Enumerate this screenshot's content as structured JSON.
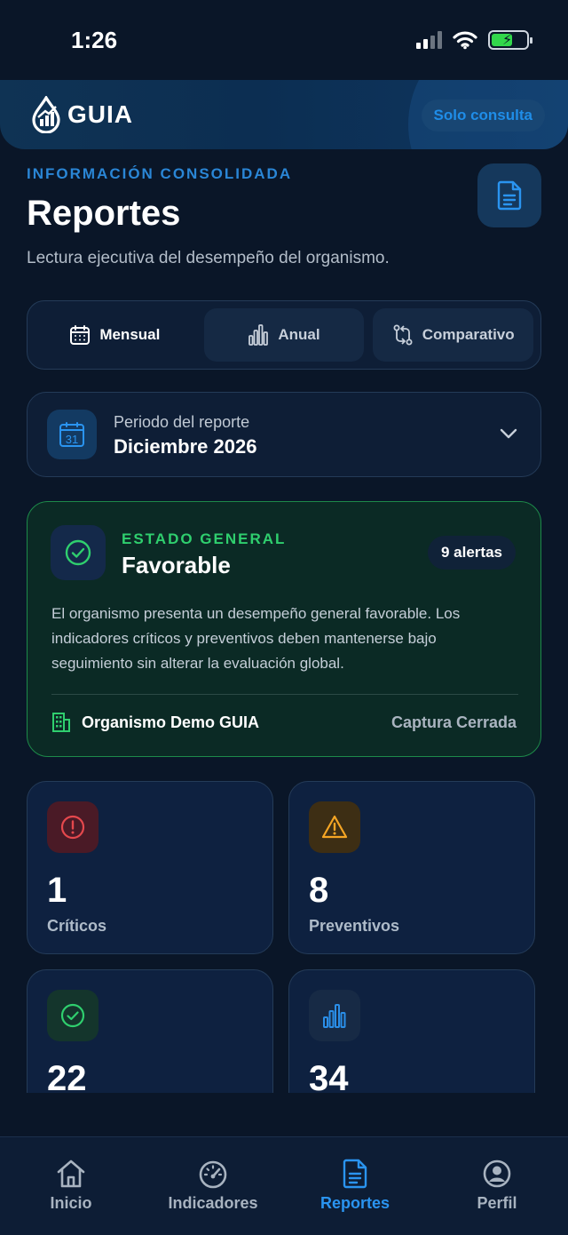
{
  "status_bar": {
    "time": "1:26"
  },
  "header": {
    "logo_text": "GUIA",
    "badge": "Solo consulta"
  },
  "page": {
    "eyebrow": "INFORMACIÓN CONSOLIDADA",
    "title": "Reportes",
    "subtitle": "Lectura ejecutiva del desempeño del organismo."
  },
  "segment": {
    "items": [
      {
        "label": "Mensual",
        "icon": "calendar-icon"
      },
      {
        "label": "Anual",
        "icon": "bar-chart-icon"
      },
      {
        "label": "Comparativo",
        "icon": "compare-icon"
      }
    ],
    "selected": "Mensual"
  },
  "period": {
    "icon_day": "31",
    "label": "Periodo del reporte",
    "value": "Diciembre 2026"
  },
  "status_card": {
    "eyebrow": "ESTADO GENERAL",
    "title": "Favorable",
    "alerts": "9 alertas",
    "description": "El organismo presenta un desempeño general favorable. Los indicadores críticos y preventivos deben mantenerse bajo seguimiento sin alterar la evaluación global.",
    "organization": "Organismo Demo GUIA",
    "capture_status": "Captura Cerrada"
  },
  "metrics": [
    {
      "value": "1",
      "label": "Críticos",
      "color": "#e5484d"
    },
    {
      "value": "8",
      "label": "Preventivos",
      "color": "#f5a524"
    },
    {
      "value": "22",
      "label": "",
      "color": "#2fcf6e"
    },
    {
      "value": "34",
      "label": "",
      "color": "#2a8ee8"
    }
  ],
  "nav": {
    "items": [
      {
        "label": "Inicio"
      },
      {
        "label": "Indicadores"
      },
      {
        "label": "Reportes"
      },
      {
        "label": "Perfil"
      }
    ],
    "active": "Reportes"
  },
  "colors": {
    "background": "#0a1628",
    "accent": "#2a94f0",
    "success": "#2fcf6e"
  }
}
